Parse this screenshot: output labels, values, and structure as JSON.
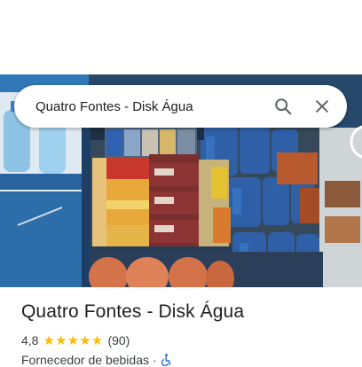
{
  "search": {
    "query": "Quatro Fontes - Disk Água",
    "search_icon": "search-icon",
    "close_icon": "close-icon"
  },
  "place": {
    "name": "Quatro Fontes - Disk Água",
    "rating": "4,8",
    "stars": 5,
    "review_count": "(90)",
    "category": "Fornecedor de bebidas",
    "separator": "·",
    "accessibility_icon": "wheelchair-icon"
  },
  "colors": {
    "star": "#fbbc04",
    "accessibility": "#1a73e8",
    "text": "#202124",
    "secondary_text": "#3c4043"
  }
}
